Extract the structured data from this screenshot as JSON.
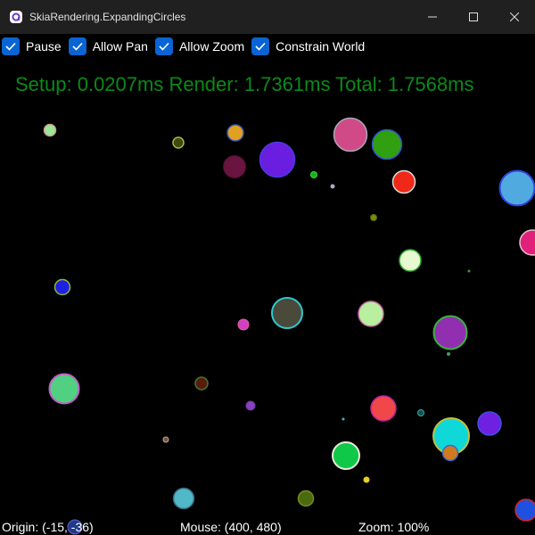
{
  "window": {
    "title": "SkiaRendering.ExpandingCircles"
  },
  "toolbar": {
    "checkboxes": [
      {
        "label": "Pause",
        "checked": true
      },
      {
        "label": "Allow Pan",
        "checked": true
      },
      {
        "label": "Allow Zoom",
        "checked": true
      },
      {
        "label": "Constrain World",
        "checked": true
      }
    ]
  },
  "perf": {
    "text": "Setup: 0.0207ms Render: 1.7361ms Total: 1.7568ms",
    "color": "#0a8a1a"
  },
  "status": {
    "origin": "Origin: (-15, -36)",
    "mouse": "Mouse: (400, 480)",
    "zoom": "Zoom: 100%"
  },
  "colors": {
    "accent": "#0a64d3",
    "titlebar": "#202020",
    "background": "#000000"
  }
}
